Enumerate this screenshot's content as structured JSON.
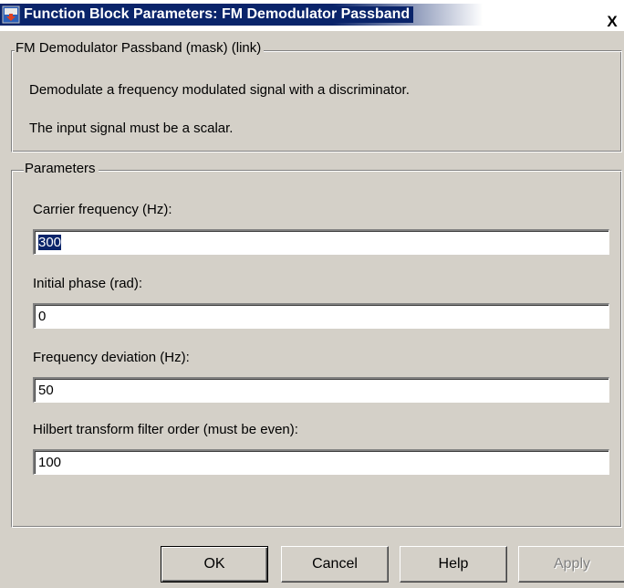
{
  "window": {
    "title": "Function Block Parameters: FM Demodulator Passband",
    "close_label": "X"
  },
  "mask_group": {
    "legend": "FM Demodulator Passband (mask) (link)",
    "description_line1": "Demodulate a frequency modulated signal with a discriminator.",
    "description_line2": "The input signal must be a scalar."
  },
  "params_group": {
    "legend": "Parameters",
    "fields": [
      {
        "label": "Carrier frequency (Hz):",
        "value": "300"
      },
      {
        "label": "Initial phase (rad):",
        "value": "0"
      },
      {
        "label": "Frequency deviation (Hz):",
        "value": "50"
      },
      {
        "label": "Hilbert transform filter order (must be even):",
        "value": "100"
      }
    ]
  },
  "buttons": {
    "ok": "OK",
    "cancel": "Cancel",
    "help": "Help",
    "apply": "Apply"
  },
  "colors": {
    "titlebar_active": "#0a246a",
    "dialog_face": "#d4d0c8",
    "selection": "#0a246a"
  },
  "icons": {
    "title_icon": "simulink-block-icon",
    "close_icon": "close-icon"
  }
}
